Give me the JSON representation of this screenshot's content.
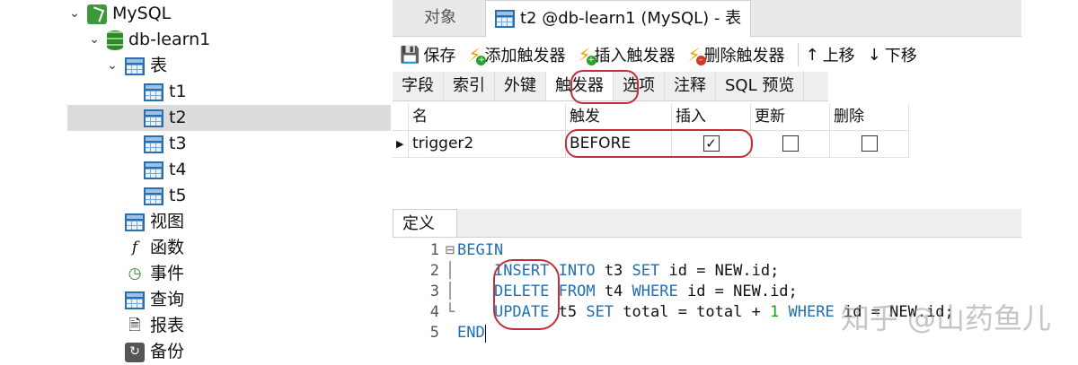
{
  "tree": {
    "connection": "MySQL",
    "database": "db-learn1",
    "tables_group": "表",
    "tables": [
      "t1",
      "t2",
      "t3",
      "t4",
      "t5"
    ],
    "selected_table": "t2",
    "others": [
      "视图",
      "函数",
      "事件",
      "查询",
      "报表",
      "备份"
    ]
  },
  "tabs": {
    "objects": "对象",
    "active": "t2 @db-learn1 (MySQL) - 表"
  },
  "toolbar": {
    "save": "保存",
    "add_trigger": "添加触发器",
    "insert_trigger": "插入触发器",
    "delete_trigger": "删除触发器",
    "move_up": "上移",
    "move_down": "下移"
  },
  "subtabs": [
    "字段",
    "索引",
    "外键",
    "触发器",
    "选项",
    "注释",
    "SQL 预览"
  ],
  "grid": {
    "headers": [
      "名",
      "触发",
      "插入",
      "更新",
      "删除"
    ],
    "row": {
      "name": "trigger2",
      "timing": "BEFORE",
      "insert": true,
      "update": false,
      "delete": false
    }
  },
  "definition_tab": "定义",
  "code": {
    "line_numbers": [
      "1",
      "2",
      "3",
      "4",
      "5"
    ],
    "begin": "BEGIN",
    "l2": {
      "kw1": "INSERT",
      "kw2": "INTO",
      "t": " t3 ",
      "kw3": "SET",
      "rest": " id = NEW.id;"
    },
    "l3": {
      "kw1": "DELETE",
      "kw2": "FROM",
      "t": " t4 ",
      "kw3": "WHERE",
      "rest": " id = NEW.id;"
    },
    "l4": {
      "kw1": "UPDATE",
      "t": " t5 ",
      "kw3": "SET",
      "mid": " total = total + ",
      "num": "1",
      "kw4": " WHERE",
      "rest": " id = NEW.id;"
    },
    "end": "END"
  },
  "watermark": "知乎 @山药鱼儿",
  "colors": {
    "accent": "#1f6fb7",
    "highlight_circle": "#c0303a",
    "selected_row": "#dcdcdc"
  }
}
